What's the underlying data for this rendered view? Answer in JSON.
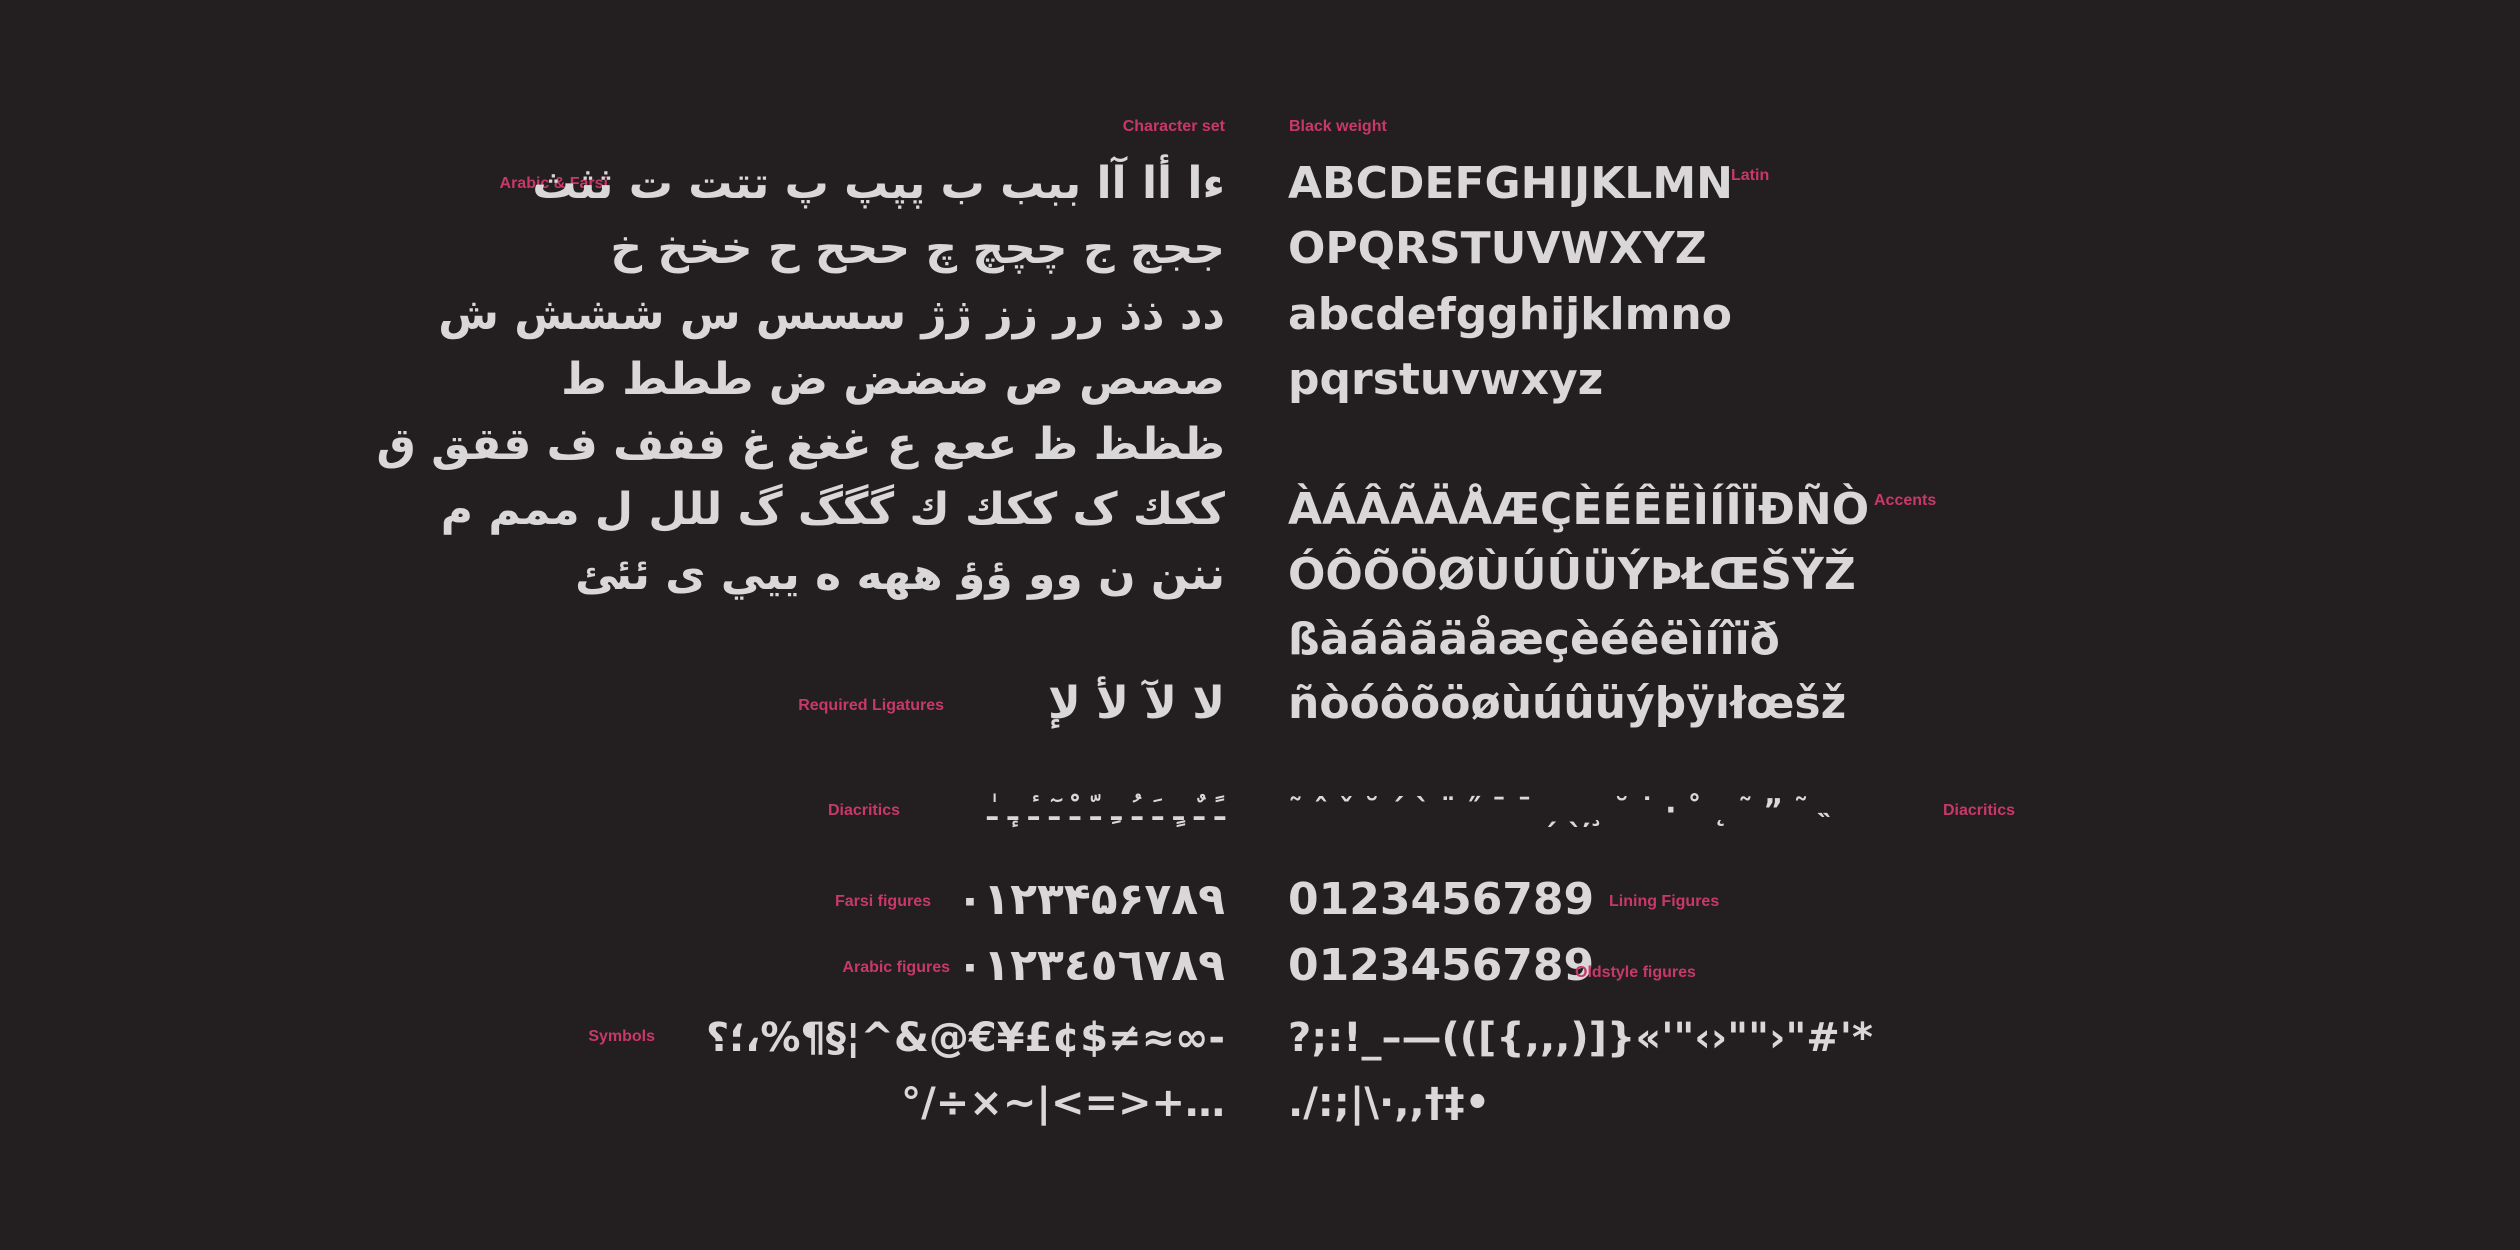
{
  "colors": {
    "background": "#231f20",
    "label": "#c8386a",
    "glyph": "#d9d7d7"
  },
  "labels": {
    "character_set": "Character set",
    "black_weight": "Black weight",
    "arabic_farsi": "Arabic & Farsi",
    "latin": "Latin",
    "accents": "Accents",
    "required_ligatures": "Required Ligatures",
    "diacritics_left": "Diacritics",
    "diacritics_right": "Diacritics",
    "farsi_figures": "Farsi figures",
    "lining_figures": "Lining Figures",
    "arabic_figures": "Arabic figures",
    "oldstyle_figures": "Oldstyle figures",
    "symbols": "Symbols"
  },
  "arabic": {
    "rows": [
      "ءا أا آا ببب ب پپپ پ تتت ت ثثث",
      "ججج ج چچچ چ ححح ح خخخ خ",
      "دد ذذ رر زز ژژ سسس س ششش ش",
      "صصص ص ضضض ض ططط ط",
      "ظظظ ظ ععع ع غغغ غ ففف ف ققق ق",
      "ككك ک ككك ك گگگ گ للل ل ممم م",
      "ننن ن وو ؤؤ ههه ه ييي ى ئئئ"
    ],
    "ligatures": "لا لآ لأ لإ",
    "diacritics": "ـً ـٌ ـٍ ـَ ـُ ـِ ـّ ـْ ـٓ ـٔ ـٕ ـٰ",
    "farsi_figures": "۰۱۲۳۴۵۶۷۸۹",
    "arabic_figures": "٠١٢٣٤٥٦٧٨٩",
    "symbols_line1": "-∞≈≠$¢£¥€@&^¦§¶%،؛؟",
    "symbols_line2": "…+<=>|~×÷/°"
  },
  "latin": {
    "rows": [
      "ABCDEFGHIJKLMN",
      "OPQRSTUVWXYZ",
      "abcdefgghijklmno",
      "pqrstuvwxyz"
    ],
    "accent_rows": [
      "ÀÁÂÃÄÅÆÇÈÉÊËÌÍÎÏÐÑÒ",
      "ÓÔÕÖØÙÚÛÜÝÞŁŒŠŸŽ",
      "ßàáâãäåæçèéêëìíîïð",
      "ñòóôõöøùúûüýþÿıłœšž"
    ],
    "diacritics": "˜ ˆ ˇ ˘ ˊ ˋ ¨ ˝ ¯ ˉ ˏ ˎ ̦ ̧ ˘ ˙ · ˚ ˛ ˜ ˮ ˜ ˵",
    "lining_figures": "0123456789",
    "oldstyle_figures": "0123456789",
    "symbols_line1": "?;:!_–—(([{,,,)]}«'\"‹›\"\"›\"#'*",
    "symbols_line2": "./:;|\\·,,†‡•"
  }
}
